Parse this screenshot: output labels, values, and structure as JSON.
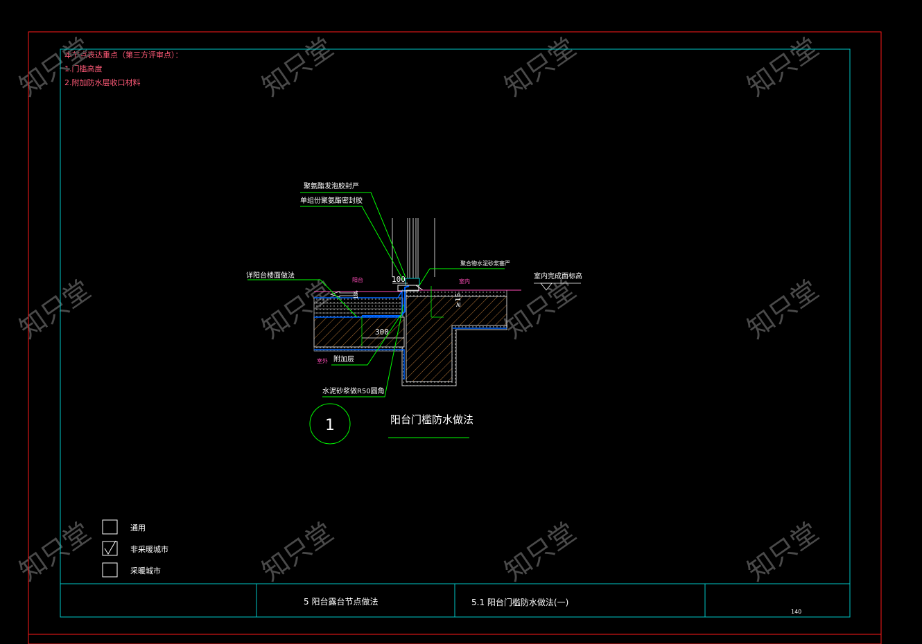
{
  "notes": {
    "heading": "本节点表达重点（第三方评审点）：",
    "item1": "1.门槛高度",
    "item2": "2.附加防水层收口材料"
  },
  "labels": {
    "sealant_foam": "聚氨酯发泡胶封严",
    "sealant_single": "单组份聚氨酯密封胶",
    "balcony_floor": "详阳台楼面做法",
    "balcony": "阳台",
    "interior": "室内",
    "polymer_mortar": "聚合物水泥砂浆塞严",
    "interior_finish": "室内完成面标高",
    "outdoor": "室外",
    "additional_layer": "附加层",
    "mortar_round": "水泥砂浆做R50圆角",
    "height_note": "≥15",
    "slope": "1%",
    "dim_100": "100",
    "dim_300": "300"
  },
  "detail": {
    "number": "1",
    "title": "阳台门槛防水做法"
  },
  "checkboxes": [
    {
      "label": "通用",
      "checked": false
    },
    {
      "label": "非采暖城市",
      "checked": true
    },
    {
      "label": "采暖城市",
      "checked": false
    }
  ],
  "title_block": {
    "chapter": "5  阳台露台节点做法",
    "section": "5.1  阳台门槛防水做法(一)",
    "page": "140"
  },
  "watermark": "知只堂",
  "colors": {
    "outer_frame": "#ff1a1a",
    "inner_frame": "#00c8c8",
    "leader": "#00ff00",
    "waterproof": "#0066ff",
    "note": "#ff5a78"
  }
}
